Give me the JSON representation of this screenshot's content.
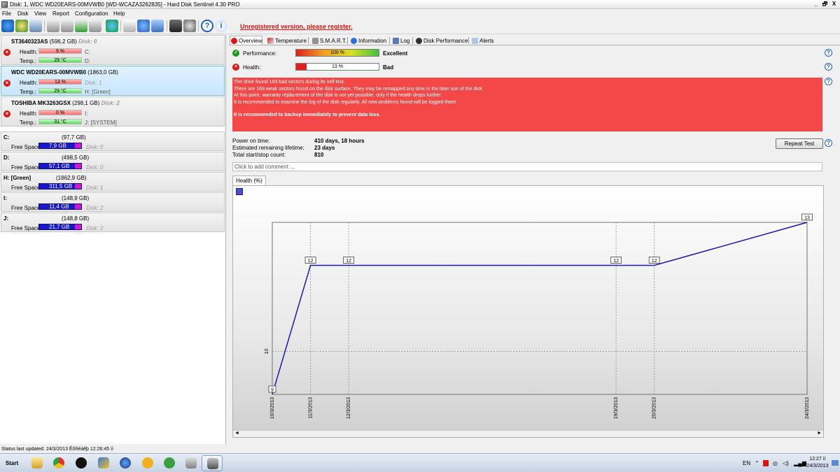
{
  "window": {
    "title": "Disk: 1, WDC WD20EARS-00MVWB0 [WD-WCAZA3262835]  -  Hard Disk Sentinel 4.30 PRO",
    "min": "_",
    "restore": "🗗",
    "close": "X"
  },
  "menu": [
    "File",
    "Disk",
    "View",
    "Report",
    "Configuration",
    "Help"
  ],
  "toolbar": {
    "unregistered": "Unregistered version, please register."
  },
  "disks": [
    {
      "name": "ST3640323AS",
      "size": "(596,2 GB)",
      "disk": "Disk: 0",
      "health_label": "Health:",
      "health": "9 %",
      "health_pct": 9,
      "temp_label": "Temp.:",
      "temp": "29 °C",
      "drive1": "C:",
      "drive2": "D:"
    },
    {
      "name": "WDC WD20EARS-00MVWB0",
      "size": "(1863,0 GB)",
      "disk": "",
      "health_label": "Health:",
      "health": "13 %",
      "health_pct": 13,
      "temp_label": "Temp.:",
      "temp": "29 °C",
      "drive1": "Disk: 1",
      "drive2": "H: [Green]"
    },
    {
      "name": "TOSHIBA MK3263GSX",
      "size": "(298,1 GB)",
      "disk": "Disk: 2",
      "health_label": "Health:",
      "health": "0 %",
      "health_pct": 0,
      "temp_label": "Temp.:",
      "temp": "31 °C",
      "drive1": "I:",
      "drive2": "J: [SYSTEM]"
    }
  ],
  "volumes": [
    {
      "name": "C:",
      "size": "(97,7 GB)",
      "fs_label": "Free Space",
      "free": "7,9 GB",
      "disk": "Disk: 0"
    },
    {
      "name": "D:",
      "size": "(498,5 GB)",
      "fs_label": "Free Space",
      "free": "57,1 GB",
      "disk": "Disk: 0"
    },
    {
      "name": "H: [Green]",
      "size": "(1862,9 GB)",
      "fs_label": "Free Space",
      "free": "311,5 GB",
      "disk": "Disk: 1"
    },
    {
      "name": "I:",
      "size": "(148,9 GB)",
      "fs_label": "Free Space",
      "free": "11,4 GB",
      "disk": "Disk: 2"
    },
    {
      "name": "J:",
      "size": "(148,8 GB)",
      "fs_label": "Free Space",
      "free": "21,7 GB",
      "disk": "Disk: 2"
    }
  ],
  "tabs": [
    "Overview",
    "Temperature",
    "S.M.A.R.T.",
    "Information",
    "Log",
    "Disk Performance",
    "Alerts"
  ],
  "overview": {
    "performance_label": "Performance:",
    "performance_value": "100 %",
    "performance_pct": 100,
    "performance_text": "Excellent",
    "health_label": "Health:",
    "health_value": "13 %",
    "health_pct": 13,
    "health_text": "Bad",
    "alert_lines": [
      "The drive found 169 bad sectors during its self test.",
      "There are 169 weak sectors found on the disk surface. They may be remapped any time in the later use of the disk.",
      "At this point, warranty replacement of the disk is not yet possible, only if the health drops further.",
      "It is recommended to examine the log of the disk regularly. All new problems found will be logged there."
    ],
    "alert_strong": "It is recommended to backup immediately to prevent data loss.",
    "power_on_label": "Power on time:",
    "power_on_value": "410 days, 18 hours",
    "lifetime_label": "Estimated remaining lifetime:",
    "lifetime_value": "23 days",
    "startstop_label": "Total start/stop count:",
    "startstop_value": "810",
    "repeat_button": "Repeat Test",
    "comment_placeholder": "Click to add comment ...",
    "graph_tab": "Health (%)"
  },
  "chart_data": {
    "type": "line",
    "x": [
      "10/3/2013",
      "11/3/2013",
      "12/3/2013",
      "19/3/2013",
      "20/3/2013",
      "24/3/2013"
    ],
    "values": [
      9,
      12,
      12,
      12,
      12,
      13
    ],
    "data_labels": [
      "9",
      "12",
      "12",
      "12",
      "12",
      "13"
    ],
    "ytick_labels": [
      "10"
    ],
    "line_color": "#1a1aa8"
  },
  "status": {
    "text": "Status last updated: 24/3/2013 Êõñéáêþ 12:26:45 ìì"
  },
  "taskbar": {
    "start": "Start",
    "lang": "EN",
    "time": "12:27 ìì",
    "date": "24/3/2013"
  }
}
